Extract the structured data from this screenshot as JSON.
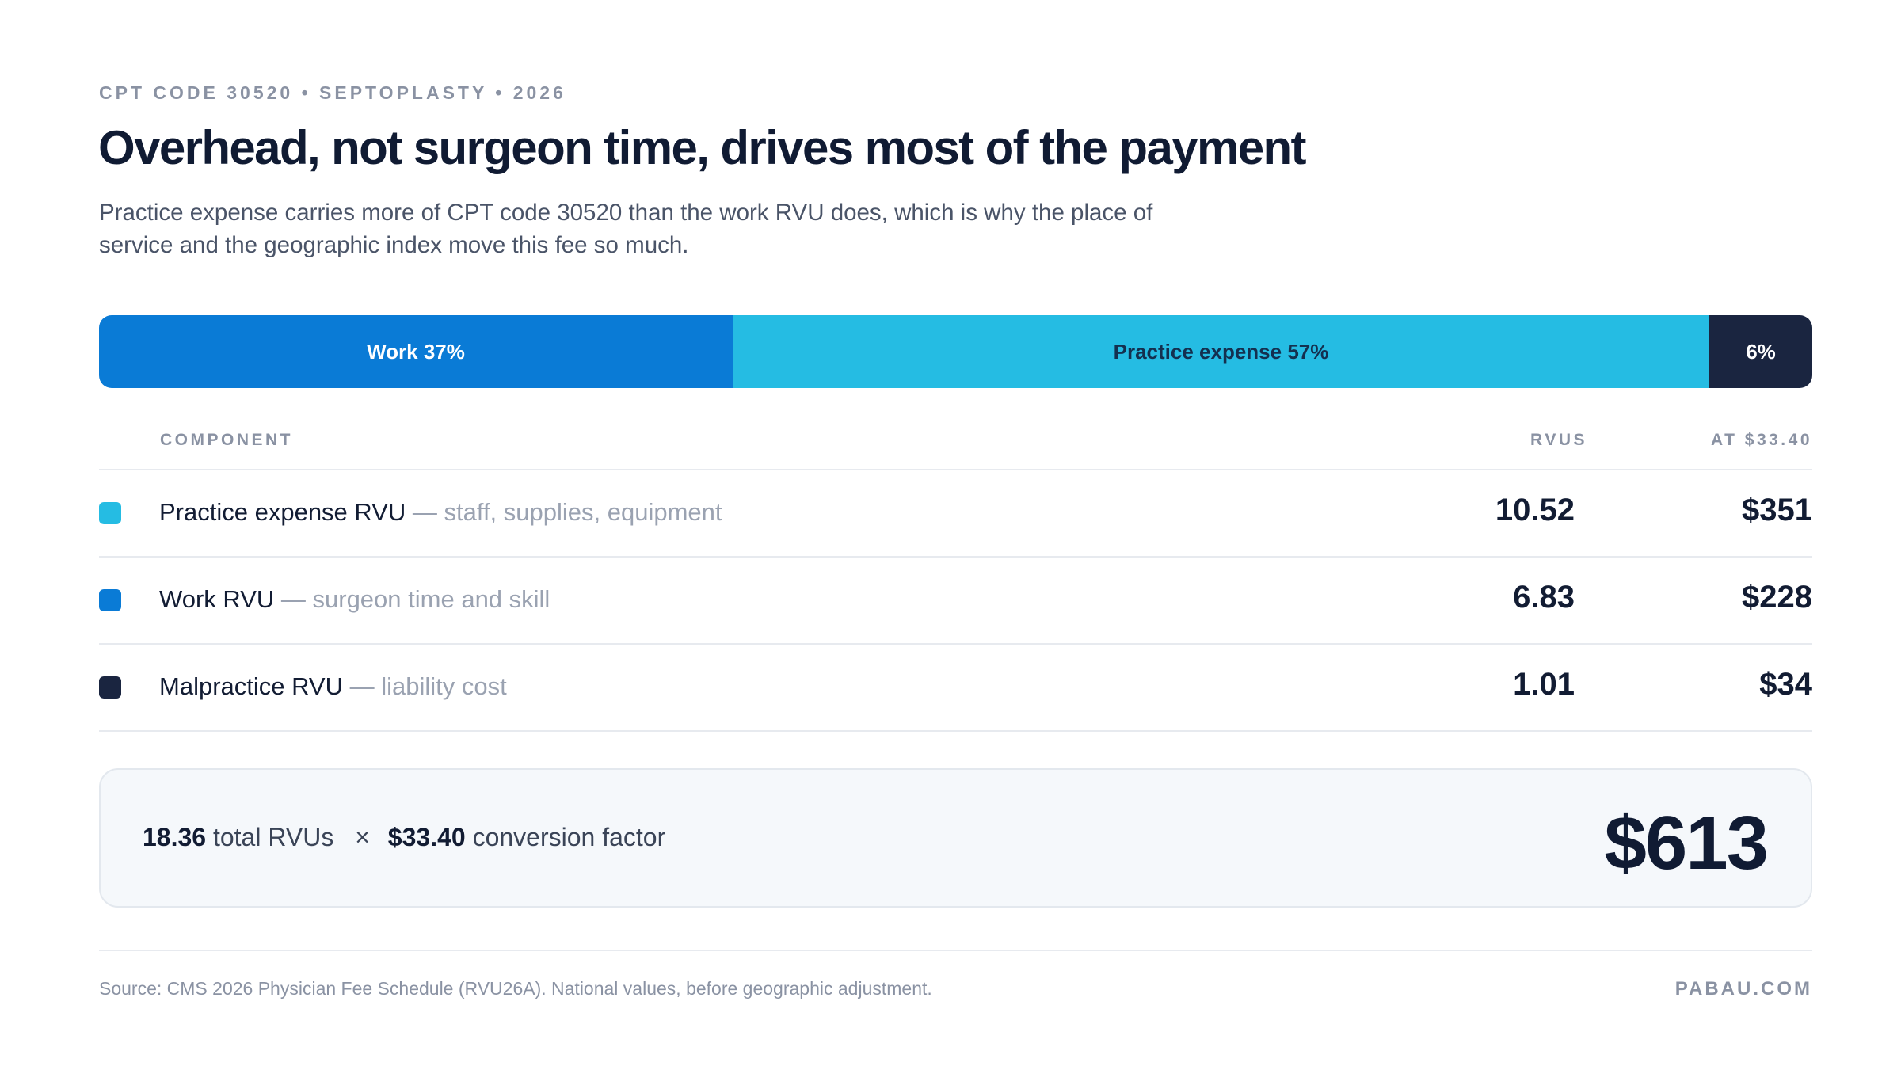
{
  "header": {
    "eyebrow": "CPT CODE 30520 • SEPTOPLASTY • 2026",
    "title": "Overhead, not surgeon time, drives most of the payment",
    "subtitle": "Practice expense carries more of CPT code 30520 than the work RVU does, which is why the place of service and the geographic index move this fee so much."
  },
  "colors": {
    "work": "#0a7bd6",
    "practice_expense": "#25bce3",
    "malpractice": "#1a2540"
  },
  "chart_data": {
    "type": "bar",
    "orientation": "horizontal-stacked-100",
    "segments": [
      {
        "name": "Work",
        "percent": 37,
        "label": "Work 37%",
        "color": "#0a7bd6"
      },
      {
        "name": "Practice expense",
        "percent": 57,
        "label": "Practice expense 57%",
        "color": "#25bce3"
      },
      {
        "name": "",
        "percent": 6,
        "label": "6%",
        "color": "#1a2540"
      }
    ]
  },
  "table": {
    "headers": {
      "component": "COMPONENT",
      "rvus": "RVUS",
      "dollars": "AT $33.40"
    },
    "rows": [
      {
        "name": "Practice expense RVU",
        "desc": " — staff, supplies, equipment",
        "rvus": "10.52",
        "dollars": "$351",
        "color": "#25bce3"
      },
      {
        "name": "Work RVU",
        "desc": " — surgeon time and skill",
        "rvus": "6.83",
        "dollars": "$228",
        "color": "#0a7bd6"
      },
      {
        "name": "Malpractice RVU",
        "desc": " — liability cost",
        "rvus": "1.01",
        "dollars": "$34",
        "color": "#1a2540"
      }
    ]
  },
  "total": {
    "rvus": "18.36",
    "rvus_label": "total RVUs",
    "times": "×",
    "factor": "$33.40",
    "factor_label": "conversion factor",
    "value": "$613"
  },
  "footer": {
    "source": "Source: CMS 2026 Physician Fee Schedule (RVU26A). National values, before geographic adjustment.",
    "brand": "PABAU.COM"
  }
}
